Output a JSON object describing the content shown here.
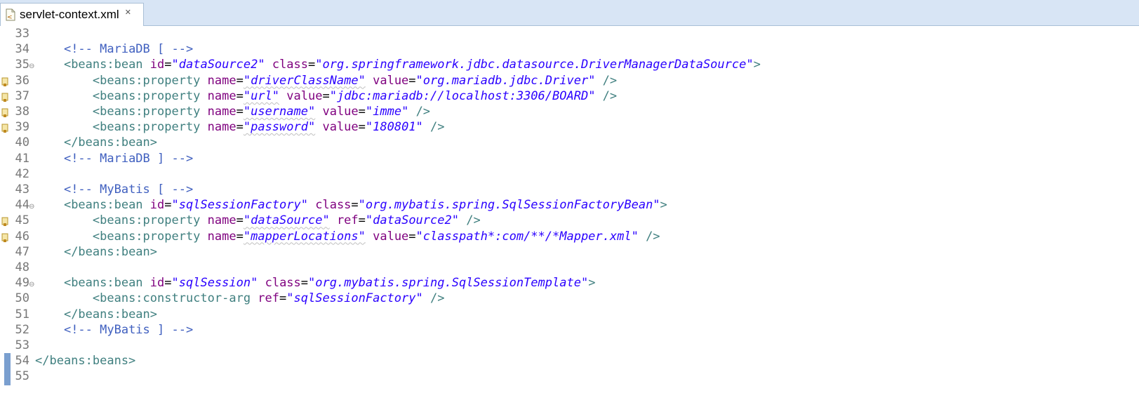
{
  "tab": {
    "title": "servlet-context.xml",
    "close_glyph": "✕",
    "icon": "xml-file-icon"
  },
  "colors": {
    "tabbar_bg": "#d8e5f5",
    "comment": "#3f5fbf",
    "tag": "#3f7f7f",
    "attribute": "#7f007f",
    "value": "#2a00ff",
    "line_number": "#787878",
    "change_bar": "#7a9fcf"
  },
  "lines": [
    {
      "num": "33",
      "tokens": []
    },
    {
      "num": "34",
      "tokens": [
        {
          "t": "    ",
          "k": "punct"
        },
        {
          "t": "<!-- MariaDB [ -->",
          "k": "comment"
        }
      ]
    },
    {
      "num": "35",
      "fold": "⊖",
      "tokens": [
        {
          "t": "    ",
          "k": "punct"
        },
        {
          "t": "<beans:bean ",
          "k": "tag"
        },
        {
          "t": "id",
          "k": "attr"
        },
        {
          "t": "=",
          "k": "punct"
        },
        {
          "t": "\"dataSource2\"",
          "k": "val"
        },
        {
          "t": " ",
          "k": "punct"
        },
        {
          "t": "class",
          "k": "attr"
        },
        {
          "t": "=",
          "k": "punct"
        },
        {
          "t": "\"org.springframework.jdbc.datasource.DriverManagerDataSource\"",
          "k": "val"
        },
        {
          "t": ">",
          "k": "tag"
        }
      ]
    },
    {
      "num": "36",
      "marker": true,
      "tokens": [
        {
          "t": "        ",
          "k": "punct"
        },
        {
          "t": "<beans:property ",
          "k": "tag"
        },
        {
          "t": "name",
          "k": "attr"
        },
        {
          "t": "=",
          "k": "punct"
        },
        {
          "t": "\"driverClassName\"",
          "k": "val",
          "squiggle": true
        },
        {
          "t": " ",
          "k": "punct"
        },
        {
          "t": "value",
          "k": "attr"
        },
        {
          "t": "=",
          "k": "punct"
        },
        {
          "t": "\"org.mariadb.jdbc.Driver\"",
          "k": "val"
        },
        {
          "t": " />",
          "k": "tag"
        }
      ]
    },
    {
      "num": "37",
      "marker": true,
      "tokens": [
        {
          "t": "        ",
          "k": "punct"
        },
        {
          "t": "<beans:property ",
          "k": "tag"
        },
        {
          "t": "name",
          "k": "attr"
        },
        {
          "t": "=",
          "k": "punct"
        },
        {
          "t": "\"url\"",
          "k": "val",
          "squiggle": true
        },
        {
          "t": " ",
          "k": "punct"
        },
        {
          "t": "value",
          "k": "attr"
        },
        {
          "t": "=",
          "k": "punct"
        },
        {
          "t": "\"jdbc:mariadb://localhost:3306/BOARD\"",
          "k": "val"
        },
        {
          "t": " />",
          "k": "tag"
        }
      ]
    },
    {
      "num": "38",
      "marker": true,
      "tokens": [
        {
          "t": "        ",
          "k": "punct"
        },
        {
          "t": "<beans:property ",
          "k": "tag"
        },
        {
          "t": "name",
          "k": "attr"
        },
        {
          "t": "=",
          "k": "punct"
        },
        {
          "t": "\"username\"",
          "k": "val",
          "squiggle": true
        },
        {
          "t": " ",
          "k": "punct"
        },
        {
          "t": "value",
          "k": "attr"
        },
        {
          "t": "=",
          "k": "punct"
        },
        {
          "t": "\"imme\"",
          "k": "val"
        },
        {
          "t": " />",
          "k": "tag"
        }
      ]
    },
    {
      "num": "39",
      "marker": true,
      "tokens": [
        {
          "t": "        ",
          "k": "punct"
        },
        {
          "t": "<beans:property ",
          "k": "tag"
        },
        {
          "t": "name",
          "k": "attr"
        },
        {
          "t": "=",
          "k": "punct"
        },
        {
          "t": "\"password\"",
          "k": "val",
          "squiggle": true
        },
        {
          "t": " ",
          "k": "punct"
        },
        {
          "t": "value",
          "k": "attr"
        },
        {
          "t": "=",
          "k": "punct"
        },
        {
          "t": "\"180801\"",
          "k": "val"
        },
        {
          "t": " />",
          "k": "tag"
        }
      ]
    },
    {
      "num": "40",
      "tokens": [
        {
          "t": "    ",
          "k": "punct"
        },
        {
          "t": "</beans:bean>",
          "k": "tag"
        }
      ]
    },
    {
      "num": "41",
      "tokens": [
        {
          "t": "    ",
          "k": "punct"
        },
        {
          "t": "<!-- MariaDB ] -->",
          "k": "comment"
        }
      ]
    },
    {
      "num": "42",
      "tokens": []
    },
    {
      "num": "43",
      "tokens": [
        {
          "t": "    ",
          "k": "punct"
        },
        {
          "t": "<!-- MyBatis [ -->",
          "k": "comment"
        }
      ]
    },
    {
      "num": "44",
      "fold": "⊖",
      "tokens": [
        {
          "t": "    ",
          "k": "punct"
        },
        {
          "t": "<beans:bean ",
          "k": "tag"
        },
        {
          "t": "id",
          "k": "attr"
        },
        {
          "t": "=",
          "k": "punct"
        },
        {
          "t": "\"sqlSessionFactory\"",
          "k": "val"
        },
        {
          "t": " ",
          "k": "punct"
        },
        {
          "t": "class",
          "k": "attr"
        },
        {
          "t": "=",
          "k": "punct"
        },
        {
          "t": "\"org.mybatis.spring.SqlSessionFactoryBean\"",
          "k": "val"
        },
        {
          "t": ">",
          "k": "tag"
        }
      ]
    },
    {
      "num": "45",
      "marker": true,
      "tokens": [
        {
          "t": "        ",
          "k": "punct"
        },
        {
          "t": "<beans:property ",
          "k": "tag"
        },
        {
          "t": "name",
          "k": "attr"
        },
        {
          "t": "=",
          "k": "punct"
        },
        {
          "t": "\"dataSource\"",
          "k": "val",
          "squiggle": true
        },
        {
          "t": " ",
          "k": "punct"
        },
        {
          "t": "ref",
          "k": "attr"
        },
        {
          "t": "=",
          "k": "punct"
        },
        {
          "t": "\"dataSource2\"",
          "k": "val"
        },
        {
          "t": " />",
          "k": "tag"
        }
      ]
    },
    {
      "num": "46",
      "marker": true,
      "tokens": [
        {
          "t": "        ",
          "k": "punct"
        },
        {
          "t": "<beans:property ",
          "k": "tag"
        },
        {
          "t": "name",
          "k": "attr"
        },
        {
          "t": "=",
          "k": "punct"
        },
        {
          "t": "\"mapperLocations\"",
          "k": "val",
          "squiggle": true
        },
        {
          "t": " ",
          "k": "punct"
        },
        {
          "t": "value",
          "k": "attr"
        },
        {
          "t": "=",
          "k": "punct"
        },
        {
          "t": "\"classpath*:com/**/*Mapper.xml\"",
          "k": "val"
        },
        {
          "t": " />",
          "k": "tag"
        }
      ]
    },
    {
      "num": "47",
      "tokens": [
        {
          "t": "    ",
          "k": "punct"
        },
        {
          "t": "</beans:bean>",
          "k": "tag"
        }
      ]
    },
    {
      "num": "48",
      "tokens": []
    },
    {
      "num": "49",
      "fold": "⊖",
      "tokens": [
        {
          "t": "    ",
          "k": "punct"
        },
        {
          "t": "<beans:bean ",
          "k": "tag"
        },
        {
          "t": "id",
          "k": "attr"
        },
        {
          "t": "=",
          "k": "punct"
        },
        {
          "t": "\"sqlSession\"",
          "k": "val"
        },
        {
          "t": " ",
          "k": "punct"
        },
        {
          "t": "class",
          "k": "attr"
        },
        {
          "t": "=",
          "k": "punct"
        },
        {
          "t": "\"org.mybatis.spring.SqlSessionTemplate\"",
          "k": "val"
        },
        {
          "t": ">",
          "k": "tag"
        }
      ]
    },
    {
      "num": "50",
      "tokens": [
        {
          "t": "        ",
          "k": "punct"
        },
        {
          "t": "<beans:constructor-arg ",
          "k": "tag"
        },
        {
          "t": "ref",
          "k": "attr"
        },
        {
          "t": "=",
          "k": "punct"
        },
        {
          "t": "\"sqlSessionFactory\"",
          "k": "val"
        },
        {
          "t": " />",
          "k": "tag"
        }
      ]
    },
    {
      "num": "51",
      "tokens": [
        {
          "t": "    ",
          "k": "punct"
        },
        {
          "t": "</beans:bean>",
          "k": "tag"
        }
      ]
    },
    {
      "num": "52",
      "tokens": [
        {
          "t": "    ",
          "k": "punct"
        },
        {
          "t": "<!-- MyBatis ] -->",
          "k": "comment"
        }
      ]
    },
    {
      "num": "53",
      "tokens": []
    },
    {
      "num": "54",
      "change": true,
      "tokens": [
        {
          "t": "</beans:beans>",
          "k": "tag"
        }
      ]
    },
    {
      "num": "55",
      "tokens": []
    }
  ]
}
